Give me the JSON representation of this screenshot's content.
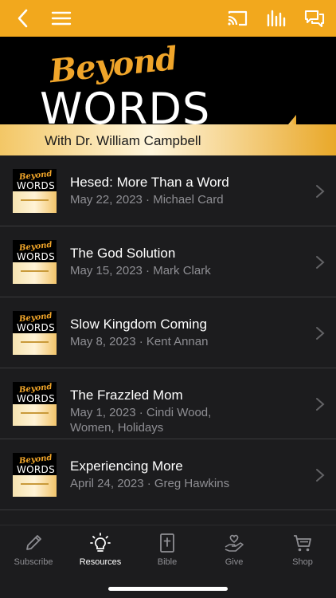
{
  "nav": {
    "back_icon": "chevron-left-icon",
    "menu_icon": "hamburger-menu-icon",
    "cast_icon": "cast-icon",
    "audio_icon": "audio-bars-icon",
    "chat_icon": "chat-bubbles-icon"
  },
  "banner": {
    "script": "Beyond",
    "title": "WORDS",
    "subtitle": "With Dr. William Campbell"
  },
  "episodes": [
    {
      "title": "Hesed: More Than a Word",
      "meta": "May 22, 2023 · Michael Card"
    },
    {
      "title": "The God Solution",
      "meta": "May 15, 2023 · Mark Clark"
    },
    {
      "title": "Slow Kingdom Coming",
      "meta": "May 8, 2023 · Kent Annan"
    },
    {
      "title": "The Frazzled Mom",
      "meta": "May 1, 2023 · Cindi Wood, Women, Holidays"
    },
    {
      "title": "Experiencing More",
      "meta": "April 24, 2023 · Greg Hawkins"
    }
  ],
  "thumb": {
    "script": "Beyond",
    "title": "WORDS"
  },
  "tabs": [
    {
      "label": "Subscribe",
      "icon": "pencil-icon"
    },
    {
      "label": "Resources",
      "icon": "lightbulb-icon"
    },
    {
      "label": "Bible",
      "icon": "bible-icon"
    },
    {
      "label": "Give",
      "icon": "heart-hand-icon"
    },
    {
      "label": "Shop",
      "icon": "cart-icon"
    }
  ],
  "colors": {
    "accent": "#f2a81d",
    "background": "#1c1c1e",
    "active_tab": "#ffffff",
    "inactive_tab": "#8e8e93"
  }
}
